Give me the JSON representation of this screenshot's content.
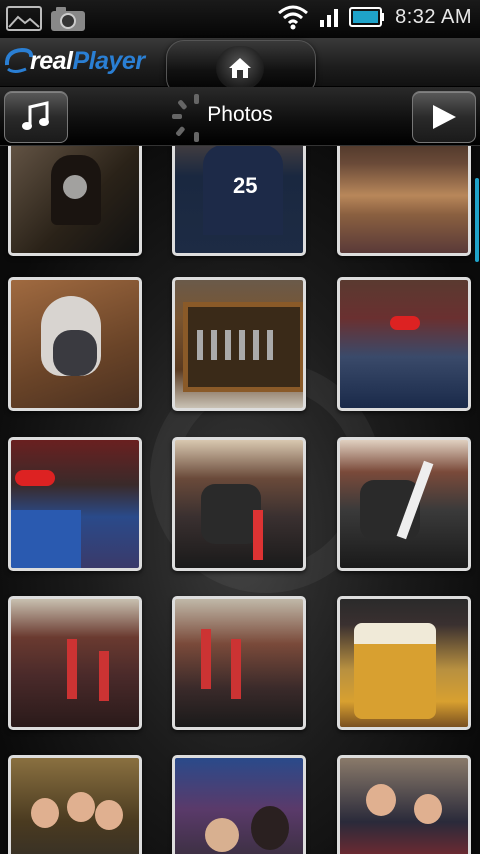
{
  "status_bar": {
    "time": "8:32 AM",
    "icons": [
      "gallery-icon",
      "camera-icon",
      "wifi-icon",
      "signal-icon",
      "battery-icon"
    ]
  },
  "header": {
    "logo_text_prefix": "real",
    "logo_text_suffix": "Player",
    "title": "Photos"
  },
  "toolbar": {
    "left_icon": "music-note-icon",
    "right_icon": "play-icon"
  },
  "colors": {
    "accent": "#1fa3c9",
    "logo_blue": "#2a7fd4",
    "thumb_border": "#dddddd"
  },
  "photos": [
    {
      "name": "photo-1"
    },
    {
      "name": "photo-2"
    },
    {
      "name": "photo-3"
    },
    {
      "name": "photo-4"
    },
    {
      "name": "photo-5"
    },
    {
      "name": "photo-6"
    },
    {
      "name": "photo-7"
    },
    {
      "name": "photo-8"
    },
    {
      "name": "photo-9"
    },
    {
      "name": "photo-10"
    },
    {
      "name": "photo-11"
    },
    {
      "name": "photo-12"
    },
    {
      "name": "photo-13"
    },
    {
      "name": "photo-14"
    },
    {
      "name": "photo-15"
    }
  ]
}
